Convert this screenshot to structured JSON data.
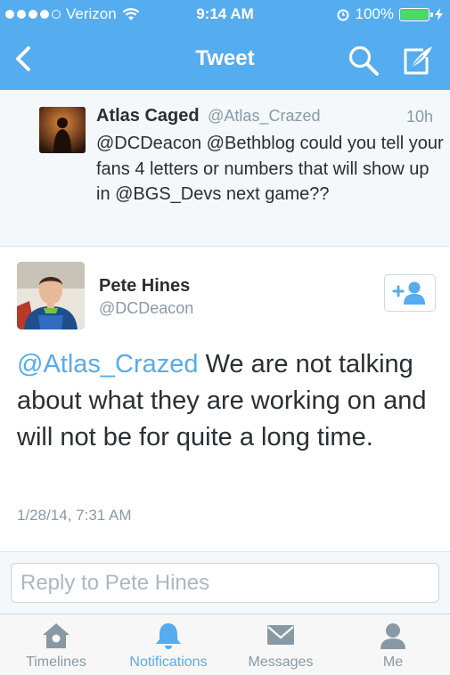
{
  "status_bar": {
    "carrier": "Verizon",
    "time": "9:14 AM",
    "battery": "100%"
  },
  "nav": {
    "title": "Tweet"
  },
  "parent_tweet": {
    "name": "Atlas Caged",
    "handle": "@Atlas_Crazed",
    "age": "10h",
    "text": "@DCDeacon @Bethblog could you tell your fans 4 letters or numbers that will show up in @BGS_Devs next game??"
  },
  "tweet": {
    "name": "Pete Hines",
    "handle": "@DCDeacon",
    "mention": "@Atlas_Crazed",
    "text": " We are not talking about what they are working on and will not be for quite a long time.",
    "timestamp": "1/28/14, 7:31 AM"
  },
  "reply": {
    "placeholder": "Reply to Pete Hines"
  },
  "tabs": [
    {
      "label": "Timelines",
      "icon": "home-icon"
    },
    {
      "label": "Notifications",
      "icon": "bell-icon"
    },
    {
      "label": "Messages",
      "icon": "envelope-icon"
    },
    {
      "label": "Me",
      "icon": "person-icon"
    }
  ],
  "colors": {
    "accent": "#55acee",
    "muted": "#8899a6",
    "text": "#292f33",
    "battery": "#4cd964"
  }
}
